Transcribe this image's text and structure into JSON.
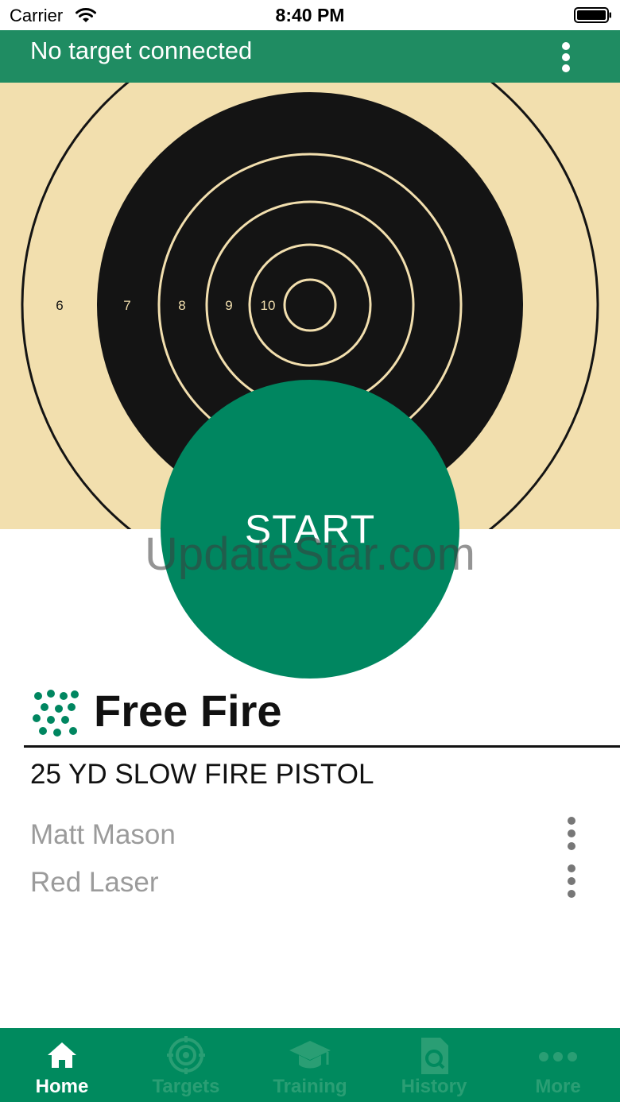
{
  "status_bar": {
    "carrier": "Carrier",
    "time": "8:40 PM"
  },
  "header": {
    "title": "No target connected",
    "menu_icon": "more-vertical-icon"
  },
  "target": {
    "ring_labels": [
      "6",
      "7",
      "8",
      "9",
      "10"
    ],
    "colors": {
      "paper": "#f2dfae",
      "black": "#141414",
      "ring_light": "#f2dfae"
    }
  },
  "start_button": {
    "label": "START",
    "color": "#008660"
  },
  "watermark": {
    "text": "UpdateStar.com"
  },
  "mode": {
    "icon": "shot-group-icon",
    "title": "Free Fire",
    "course": "25 YD SLOW FIRE PISTOL"
  },
  "list": [
    {
      "label": "Matt Mason",
      "menu_icon": "more-vertical-icon"
    },
    {
      "label": "Red Laser",
      "menu_icon": "more-vertical-icon"
    }
  ],
  "tabs": [
    {
      "label": "Home",
      "icon": "home-icon",
      "active": true
    },
    {
      "label": "Targets",
      "icon": "target-icon",
      "active": false
    },
    {
      "label": "Training",
      "icon": "graduation-cap-icon",
      "active": false
    },
    {
      "label": "History",
      "icon": "history-file-icon",
      "active": false
    },
    {
      "label": "More",
      "icon": "more-horizontal-icon",
      "active": false
    }
  ],
  "colors": {
    "header": "#1f8c62",
    "tab_bar": "#008a5e",
    "tab_inactive": "#2a9e74",
    "secondary_text": "#9b9b9b"
  }
}
